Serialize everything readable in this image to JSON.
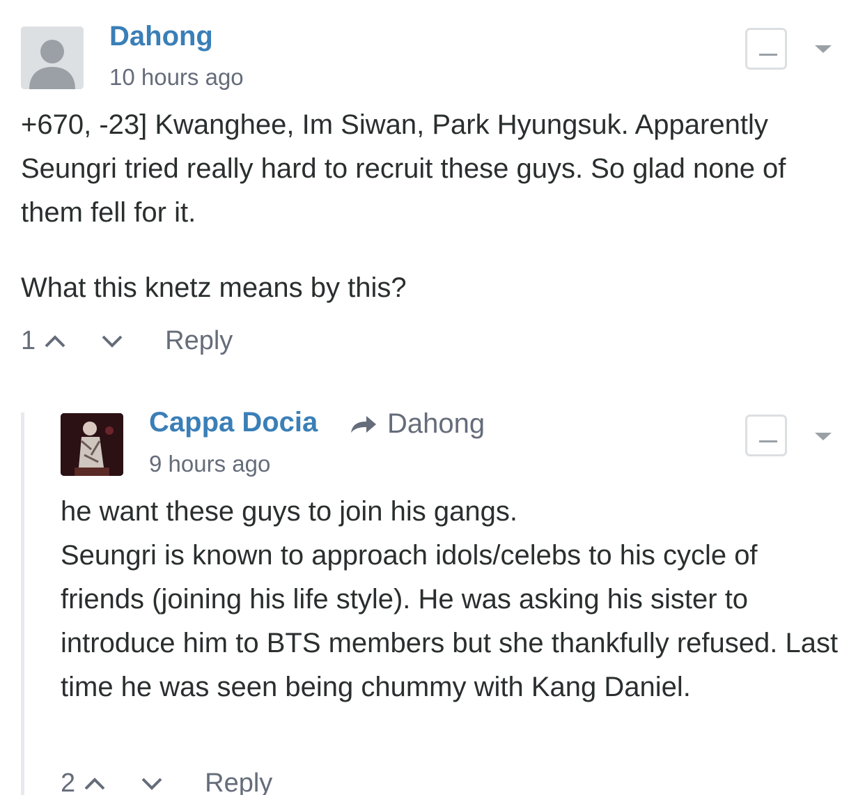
{
  "comments": [
    {
      "author": "Dahong",
      "time": "10 hours ago",
      "paragraphs": [
        "+670, -23] Kwanghee, Im Siwan, Park Hyungsuk. Apparently Seungri tried really hard to recruit these guys. So glad none of them fell for it.",
        "What this knetz means by this?"
      ],
      "votes": "1",
      "reply_label": "Reply"
    },
    {
      "author": "Cappa Docia",
      "reply_to": "Dahong",
      "time": "9 hours ago",
      "paragraphs": [
        "he want these guys to join his gangs.",
        "Seungri is known to approach idols/celebs to his cycle of friends (joining his life style). He was asking his sister to introduce him to BTS members but she thankfully refused. Last time he was seen being chummy with Kang Daniel."
      ],
      "votes": "2",
      "reply_label": "Reply"
    }
  ],
  "colors": {
    "author": "#3a7fb7",
    "meta": "#656c7a",
    "text": "#2a2e2e",
    "thread_line": "#e7e9ee"
  },
  "icons": {
    "default_avatar": "person-silhouette-icon",
    "reply_arrow": "arrow-right-icon",
    "upvote": "chevron-up-icon",
    "downvote": "chevron-down-icon",
    "collapse": "minus-icon",
    "menu": "caret-down-icon"
  }
}
